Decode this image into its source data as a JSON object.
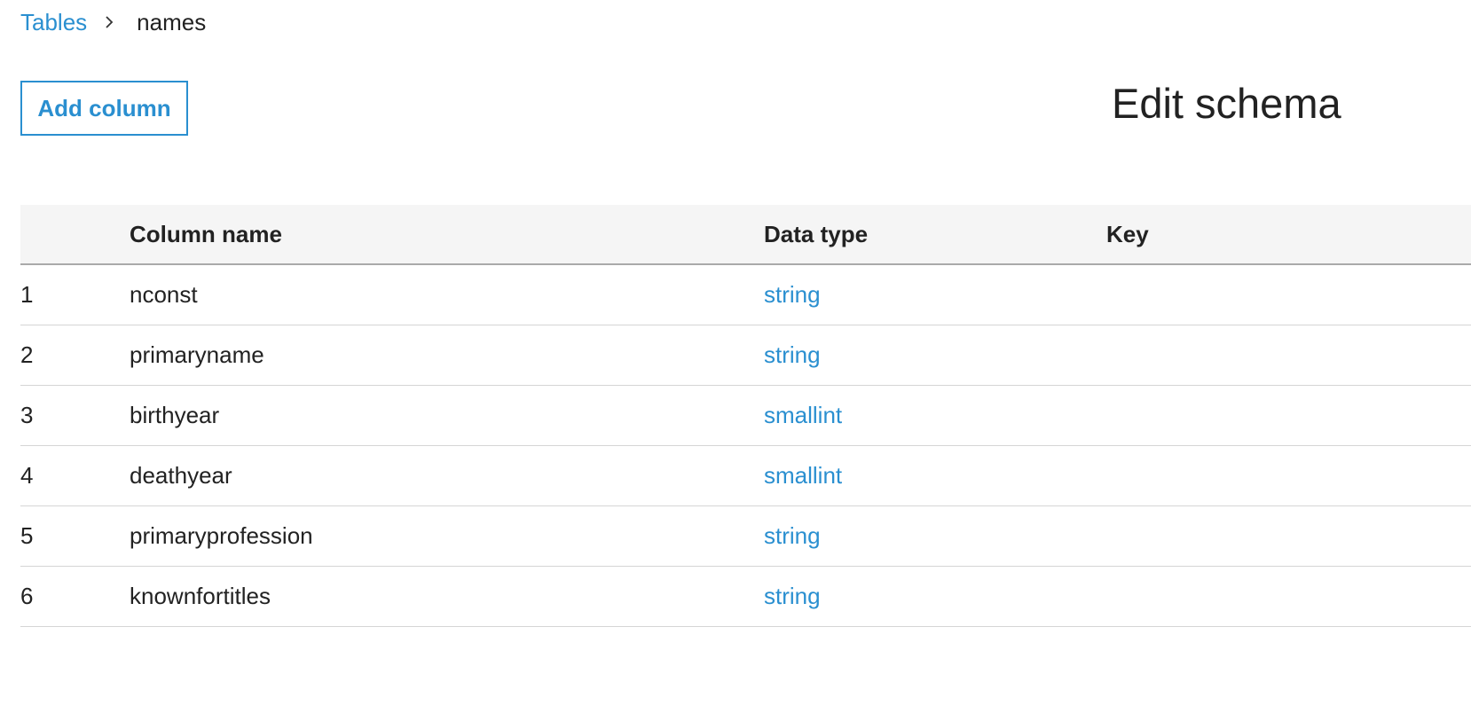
{
  "breadcrumb": {
    "parent": "Tables",
    "current": "names"
  },
  "toolbar": {
    "add_column_label": "Add column"
  },
  "page_title": "Edit schema",
  "table": {
    "headers": {
      "number": "",
      "name": "Column name",
      "type": "Data type",
      "key": "Key"
    },
    "rows": [
      {
        "number": "1",
        "name": "nconst",
        "type": "string",
        "key": ""
      },
      {
        "number": "2",
        "name": "primaryname",
        "type": "string",
        "key": ""
      },
      {
        "number": "3",
        "name": "birthyear",
        "type": "smallint",
        "key": ""
      },
      {
        "number": "4",
        "name": "deathyear",
        "type": "smallint",
        "key": ""
      },
      {
        "number": "5",
        "name": "primaryprofession",
        "type": "string",
        "key": ""
      },
      {
        "number": "6",
        "name": "knownfortitles",
        "type": "string",
        "key": ""
      }
    ]
  },
  "colors": {
    "accent": "#2a8fd0",
    "text": "#222222",
    "header_bg": "#f5f5f5"
  },
  "icons": {
    "breadcrumb_separator": "chevron-right-icon"
  }
}
